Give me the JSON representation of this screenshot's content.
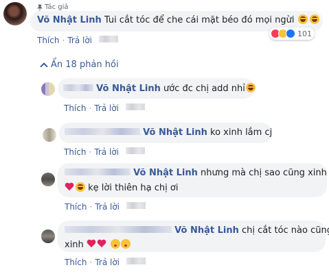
{
  "main_comment": {
    "author_tag": "Tác giả",
    "author_name": "Võ Nhật Linh",
    "text": "Tui cắt tóc để che cái mặt béo đó mọi ngừi",
    "reaction_count": "101",
    "actions": {
      "like": "Thích",
      "reply": "Trả lời"
    }
  },
  "hide_replies_label": "Ẩn 18 phản hồi",
  "replies": [
    {
      "mention": "Võ Nhật Linh",
      "text": "ước đc chị add nhỉ",
      "like": "Thích",
      "reply": "Trả lời"
    },
    {
      "mention": "Võ Nhật Linh",
      "text": "ko xinh lắm cj",
      "like": "Thích",
      "reply": "Trả lời"
    },
    {
      "mention": "Võ Nhật Linh",
      "text": "nhưng mà chị sao cũng xinh",
      "text2": "kẹ lời thiên hạ chị ơi",
      "like": "Thích",
      "reply": "Trả lời"
    },
    {
      "mention": "Võ Nhật Linh",
      "text": "chị cắt tóc nào cũng",
      "text2": "xinh",
      "like": "Thích",
      "reply": "Trả lời"
    }
  ],
  "colors": {
    "link": "#385898",
    "bubble": "#f2f3f5",
    "secondary": "#606770"
  },
  "icons": [
    "pin-icon",
    "laughing-emoji",
    "love-reaction-icon",
    "haha-reaction-icon",
    "like-reaction-icon",
    "chevron-up-icon",
    "heart-emoji",
    "kiss-emoji"
  ]
}
